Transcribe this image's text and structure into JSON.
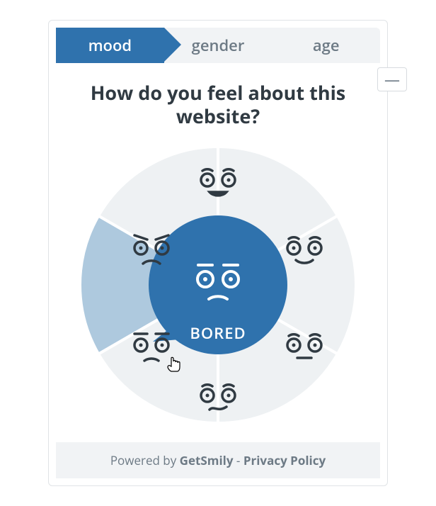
{
  "tabs": [
    {
      "label": "mood",
      "active": true
    },
    {
      "label": "gender",
      "active": false
    },
    {
      "label": "age",
      "active": false
    }
  ],
  "minimize_label": "—",
  "question": "How do you feel about this website?",
  "wheel": {
    "segments": [
      {
        "mood": "happy",
        "selected": false
      },
      {
        "mood": "satisfied",
        "selected": false
      },
      {
        "mood": "neutral",
        "selected": false
      },
      {
        "mood": "confused",
        "selected": false
      },
      {
        "mood": "bored",
        "selected": true
      },
      {
        "mood": "angry",
        "selected": false
      }
    ],
    "center_mood": "bored",
    "center_label": "BORED"
  },
  "colors": {
    "accent": "#2f72ad",
    "segment_bg": "#eef1f3",
    "segment_selected": "#aec9de",
    "segment_stroke": "#ffffff",
    "face_stroke": "#303a42",
    "text_muted": "#6d7a85"
  },
  "footer": {
    "powered": "Powered by",
    "brand": "GetSmily",
    "sep": " - ",
    "privacy": "Privacy Policy"
  }
}
